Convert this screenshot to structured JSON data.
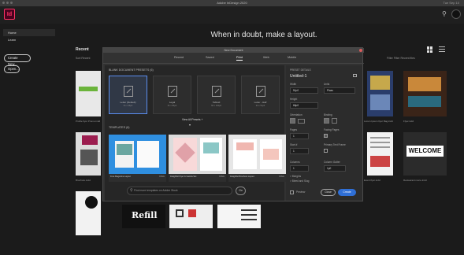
{
  "window": {
    "title": "Adobe InDesign 2020",
    "right_status": "Tue  Sep 10"
  },
  "appbar": {
    "logo": "Id",
    "search_icon": "search-icon"
  },
  "left_panel": {
    "nav": [
      "Home",
      "Learn"
    ],
    "create_new": "Create New...",
    "open": "Open..."
  },
  "main": {
    "hero": "When in doubt, make a layout.",
    "recent_title": "Recent",
    "sort_label": "Sort  Recent",
    "filter_label": "Filter  Filter Recent files",
    "right_captions": [
      "Lorem Ipsum flyer Bag.indd",
      "Flyer.indd",
      "Event flyer.indd",
      "Restaurant menu.indd"
    ],
    "left_captions": [
      "Profile flyer Promo.indd",
      "Brochure.indd"
    ]
  },
  "dialog": {
    "title": "New Document",
    "tabs": [
      "Recent",
      "Saved",
      "Print",
      "Web",
      "Mobile"
    ],
    "active_tab": "Print",
    "blank_presets_label": "BLANK DOCUMENT PRESETS (6)",
    "presets": [
      {
        "label": "Letter (Default)",
        "size": "51 x 66p0"
      },
      {
        "label": "Legal",
        "size": "51 x 84p0"
      },
      {
        "label": "Tabloid",
        "size": "66 x 102p0"
      },
      {
        "label": "Letter - Half",
        "size": "33 x 51p0"
      }
    ],
    "view_all_presets": "View All Presets +",
    "templates_label": "TEMPLATES (6)",
    "templates": [
      {
        "name": "Free Magazine Layout",
        "badge": "FREE"
      },
      {
        "name": "Delightful Flyer & Gamila Set",
        "badge": "FREE"
      },
      {
        "name": "Delightful Brochure Layout",
        "badge": "FREE"
      }
    ],
    "search_placeholder": "Find more templates on Adobe Stock",
    "search_go": "Go",
    "details": {
      "header": "PRESET DETAILS",
      "doc_name": "Untitled-1",
      "width_label": "Width",
      "width_value": "51p0",
      "units_label": "Units",
      "units_value": "Picas",
      "height_label": "Height",
      "height_value": "66p0",
      "orientation_label": "Orientation",
      "binding_label": "Binding",
      "pages_label": "Pages",
      "pages_value": "1",
      "facing_pages_label": "Facing Pages",
      "start_label": "Start #",
      "start_value": "1",
      "primary_text_frame_label": "Primary Text Frame",
      "columns_label": "Columns",
      "columns_value": "1",
      "column_gutter_label": "Column Gutter",
      "column_gutter_value": "1p0",
      "margins_label": "> Margins",
      "bleed_label": "> Bleed and Slug",
      "preview_label": "Preview",
      "close_button": "Close",
      "create_button": "Create"
    }
  },
  "colors": {
    "accent": "#2f6fd6",
    "indesign_pink": "#ff3366"
  }
}
